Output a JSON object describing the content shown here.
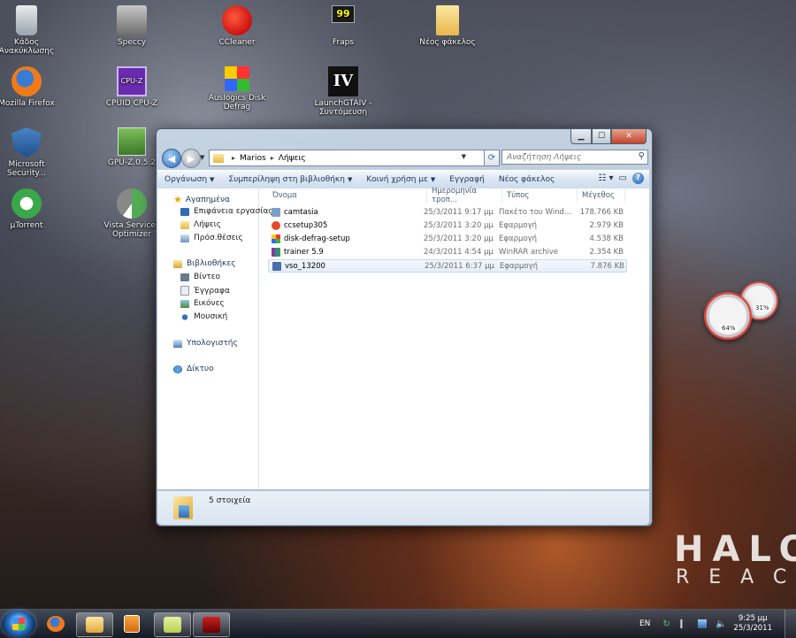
{
  "desktop": {
    "icons": [
      {
        "label": "Κάδος Ανακύκλωσης",
        "icon": "recycle-bin-icon"
      },
      {
        "label": "Speccy",
        "icon": "speccy-icon"
      },
      {
        "label": "CCleaner",
        "icon": "ccleaner-icon"
      },
      {
        "label": "Fraps",
        "icon": "fraps-icon",
        "badge": "99"
      },
      {
        "label": "Νέος φάκελος",
        "icon": "folder-icon"
      },
      {
        "label": "Mozilla Firefox",
        "icon": "firefox-icon"
      },
      {
        "label": "CPUID CPU-Z",
        "icon": "cpuz-icon",
        "badge": "CPU-Z"
      },
      {
        "label": "Auslogics Disk Defrag",
        "icon": "auslogics-icon"
      },
      {
        "label": "LaunchGTAIV - Συντόμευση",
        "icon": "gta-iv-icon",
        "badge": "IV"
      },
      {
        "label": "Microsoft Security...",
        "icon": "security-essentials-icon"
      },
      {
        "label": "GPU-Z.0.5.2",
        "icon": "gpuz-icon"
      },
      {
        "label": "µTorrent",
        "icon": "utorrent-icon"
      },
      {
        "label": "Vista Services Optimizer",
        "icon": "vista-services-icon"
      }
    ],
    "wallpaper_text": {
      "line1": "HALO",
      "line2": "REAC"
    },
    "gadgets": {
      "cpu_percent": "64%",
      "ram_percent": "31%"
    }
  },
  "window": {
    "breadcrumb": [
      "Marios",
      "Λήψεις"
    ],
    "search_placeholder": "Αναζήτηση Λήψεις",
    "toolbar": {
      "organize": "Οργάνωση",
      "include_library": "Συμπερίληψη στη βιβλιοθήκη",
      "share": "Κοινή χρήση με",
      "burn": "Εγγραφή",
      "new_folder": "Νέος φάκελος"
    },
    "nav": {
      "favorites": "Αγαπημένα",
      "favorites_items": [
        "Επιφάνεια εργασίας",
        "Λήψεις",
        "Πρόσ.θέσεις"
      ],
      "libraries": "Βιβλιοθήκες",
      "libraries_items": [
        "Βίντεο",
        "Έγγραφα",
        "Εικόνες",
        "Μουσική"
      ],
      "computer": "Υπολογιστής",
      "network": "Δίκτυο"
    },
    "columns": {
      "name": "Όνομα",
      "date": "Ημερομηνία τροπ...",
      "type": "Τύπος",
      "size": "Μέγεθος"
    },
    "files": [
      {
        "name": "camtasia",
        "date": "25/3/2011 9:17 μμ",
        "type": "Πακέτο του Wind...",
        "size": "178.766 KB",
        "icon": "installer-package-icon",
        "color": "#7a9fc9"
      },
      {
        "name": "ccsetup305",
        "date": "25/3/2011 3:20 μμ",
        "type": "Εφαρμογή",
        "size": "2.979 KB",
        "icon": "ccleaner-setup-icon",
        "color": "#e04a2a"
      },
      {
        "name": "disk-defrag-setup",
        "date": "25/3/2011 3:20 μμ",
        "type": "Εφαρμογή",
        "size": "4.538 KB",
        "icon": "defrag-setup-icon",
        "color": "#3b9a3b"
      },
      {
        "name": "trainer 5.9",
        "date": "24/3/2011 4:54 μμ",
        "type": "WinRAR archive",
        "size": "2.354 KB",
        "icon": "winrar-icon",
        "color": "#8a3a8a"
      },
      {
        "name": "vso_13200",
        "date": "25/3/2011 6:37 μμ",
        "type": "Εφαρμογή",
        "size": "7.876 KB",
        "icon": "vso-app-icon",
        "color": "#4a6fa8"
      }
    ],
    "status": "5 στοιχεία"
  },
  "taskbar": {
    "lang": "EN",
    "time": "9:25 μμ",
    "date": "25/3/2011"
  }
}
